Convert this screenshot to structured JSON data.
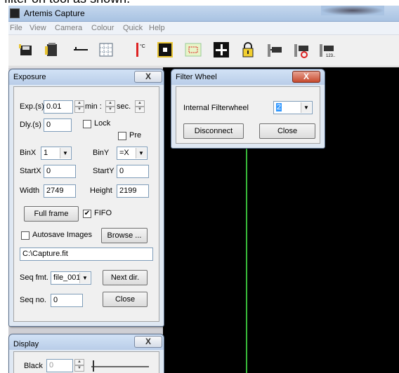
{
  "caption_top": "filter on tool as shown.",
  "app": {
    "title": "Artemis Capture"
  },
  "menu": [
    "File",
    "View",
    "Camera",
    "Colour",
    "Quick",
    "Help"
  ],
  "toolbar": [
    "save-icon",
    "film-icon",
    "line-icon",
    "grid-icon",
    "thermometer-icon",
    "focus-icon",
    "rectangle-icon",
    "crosshair-icon",
    "lock-icon",
    "connect-icon",
    "reconnect-icon",
    "sequence-icon"
  ],
  "toolbar_glyphs": {
    "thermometer": "°C",
    "sequence": "123.."
  },
  "exposure": {
    "title": "Exposure",
    "close_x": "X",
    "exp_label": "Exp.(s)",
    "exp_value": "0.01",
    "min_label": "min :",
    "sec_label": "sec.",
    "dly_label": "Dly.(s)",
    "dly_value": "0",
    "lock_label": "Lock",
    "pre_label": "Pre",
    "binx_label": "BinX",
    "binx_value": "1",
    "biny_label": "BinY",
    "biny_value": "=X",
    "startx_label": "StartX",
    "startx_value": "0",
    "starty_label": "StartY",
    "starty_value": "0",
    "width_label": "Width",
    "width_value": "2749",
    "height_label": "Height",
    "height_value": "2199",
    "fullframe_label": "Full frame",
    "fifo_label": "FIFO",
    "fifo_checked": "✔",
    "autosave_label": "Autosave Images",
    "browse_label": "Browse ...",
    "path_value": "C:\\Capture.fit",
    "seqfmt_label": "Seq fmt.",
    "seqfmt_value": "file_001",
    "nextdir_label": "Next dir.",
    "seqno_label": "Seq no.",
    "seqno_value": "0",
    "close_label": "Close"
  },
  "filterwheel": {
    "title": "Filter Wheel",
    "close_x": "X",
    "internal_label": "Internal Filterwheel",
    "selected_value": "2",
    "disconnect_label": "Disconnect",
    "close_label": "Close"
  },
  "display": {
    "title": "Display",
    "close_x": "X",
    "black_label": "Black",
    "black_value": "0"
  }
}
